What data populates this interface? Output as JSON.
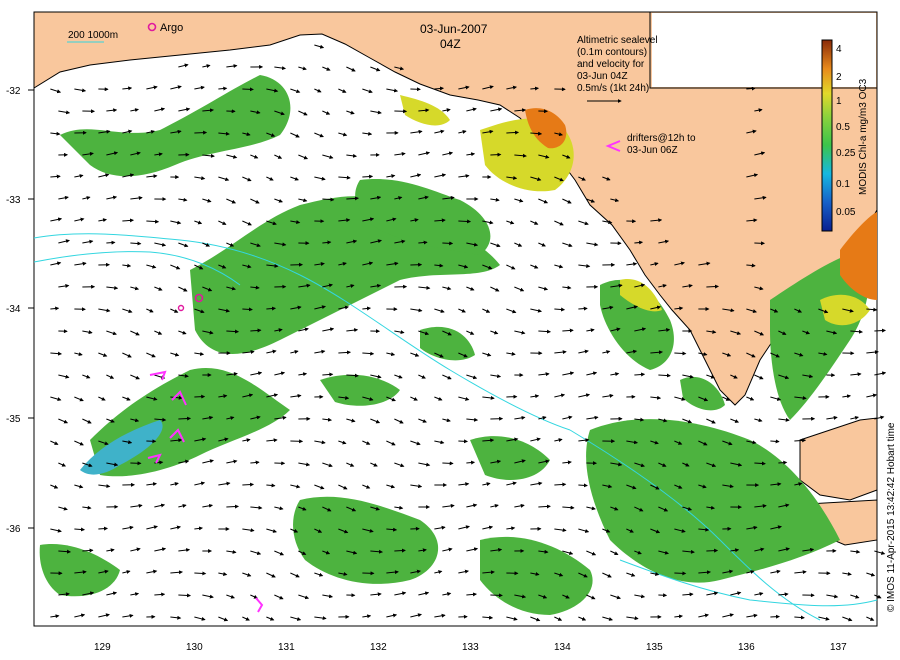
{
  "map": {
    "date": "03-Jun-2007",
    "time": "04Z",
    "scale_label": "200  1000m",
    "argo_label": "Argo",
    "legend_text": {
      "line1": "Altimetric sealevel",
      "line2": "(0.1m contours)",
      "line3": "and velocity for",
      "line4": "03-Jun 04Z",
      "line5": "0.5m/s (1kt 24h)"
    },
    "drifter_text": {
      "line1": "drifters@12h to",
      "line2": "03-Jun 06Z"
    },
    "colorbar": {
      "title": "MODIS Chl-a mg/m3 OC3",
      "ticks": [
        "4",
        "2",
        "1",
        "0.5",
        "0.25",
        "0.1",
        "0.05"
      ]
    },
    "credit": "© IMOS 11-Apr-2015 13:42:42 Hobart time",
    "lon_ticks": [
      "129",
      "130",
      "131",
      "132",
      "133",
      "134",
      "135",
      "136",
      "137"
    ],
    "lat_ticks": [
      "-32",
      "-33",
      "-34",
      "-35",
      "-36"
    ],
    "colors": {
      "land": "#f9c79d",
      "chl_green": "#4db33f",
      "chl_yellow": "#d6d92a",
      "chl_orange": "#e67a16",
      "chl_cyan": "#3fb2c9",
      "contour": "#33d6e0",
      "argo": "#e0199e",
      "drifter": "#ff33ff"
    }
  }
}
